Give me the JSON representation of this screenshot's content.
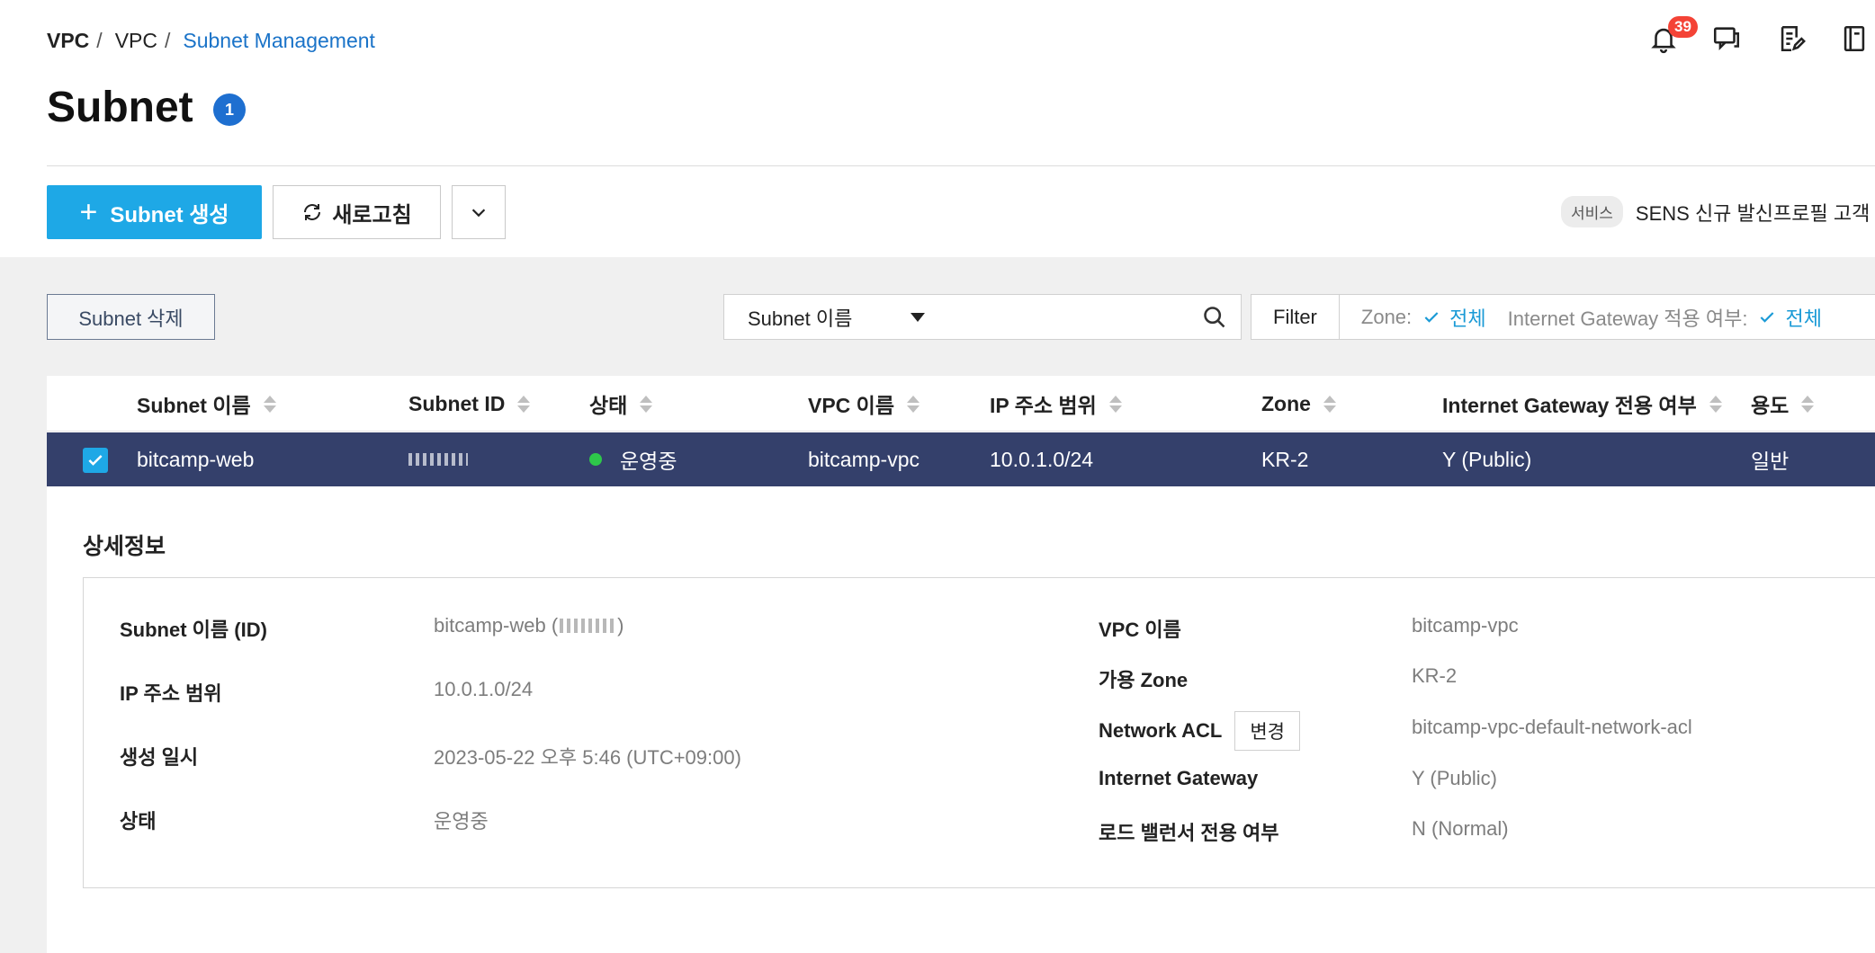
{
  "breadcrumb": {
    "level1": "VPC",
    "level2": "VPC",
    "current": "Subnet Management"
  },
  "header_icons": {
    "notification_count": "39"
  },
  "page": {
    "title": "Subnet",
    "count": "1"
  },
  "toolbar": {
    "create_label": "Subnet 생성",
    "refresh_label": "새로고침",
    "notice_tag": "서비스",
    "notice_text": "SENS 신규 발신프로필 고객"
  },
  "actions": {
    "delete_label": "Subnet 삭제"
  },
  "search": {
    "field_selected": "Subnet 이름",
    "value": ""
  },
  "filter": {
    "button_label": "Filter",
    "zone_label": "Zone:",
    "zone_value": "전체",
    "igw_label": "Internet Gateway 적용 여부:",
    "igw_value": "전체"
  },
  "table": {
    "columns": [
      "Subnet 이름",
      "Subnet ID",
      "상태",
      "VPC 이름",
      "IP 주소 범위",
      "Zone",
      "Internet Gateway 전용 여부",
      "용도"
    ],
    "rows": [
      {
        "name": "bitcamp-web",
        "status": "운영중",
        "vpc": "bitcamp-vpc",
        "ip_range": "10.0.1.0/24",
        "zone": "KR-2",
        "igw": "Y (Public)",
        "usage": "일반",
        "selected": true
      }
    ]
  },
  "detail": {
    "title": "상세정보",
    "left": [
      {
        "label": "Subnet 이름 (ID)",
        "value_prefix": "bitcamp-web (",
        "value_suffix": ")"
      },
      {
        "label": "IP 주소 범위",
        "value": "10.0.1.0/24"
      },
      {
        "label": "생성 일시",
        "value": "2023-05-22 오후 5:46 (UTC+09:00)"
      },
      {
        "label": "상태",
        "value": "운영중"
      }
    ],
    "right": [
      {
        "label": "VPC 이름",
        "value": "bitcamp-vpc"
      },
      {
        "label": "가용 Zone",
        "value": "KR-2"
      },
      {
        "label": "Network ACL",
        "value": "bitcamp-vpc-default-network-acl",
        "button": "변경"
      },
      {
        "label": "Internet Gateway",
        "value": "Y (Public)"
      },
      {
        "label": "로드 밸런서 전용 여부",
        "value": "N (Normal)"
      }
    ]
  },
  "colors": {
    "primary": "#1ea8e6",
    "selected_row": "#34406b",
    "link": "#1a73c8",
    "badge": "#f44336",
    "status_ok": "#2ec84a"
  }
}
